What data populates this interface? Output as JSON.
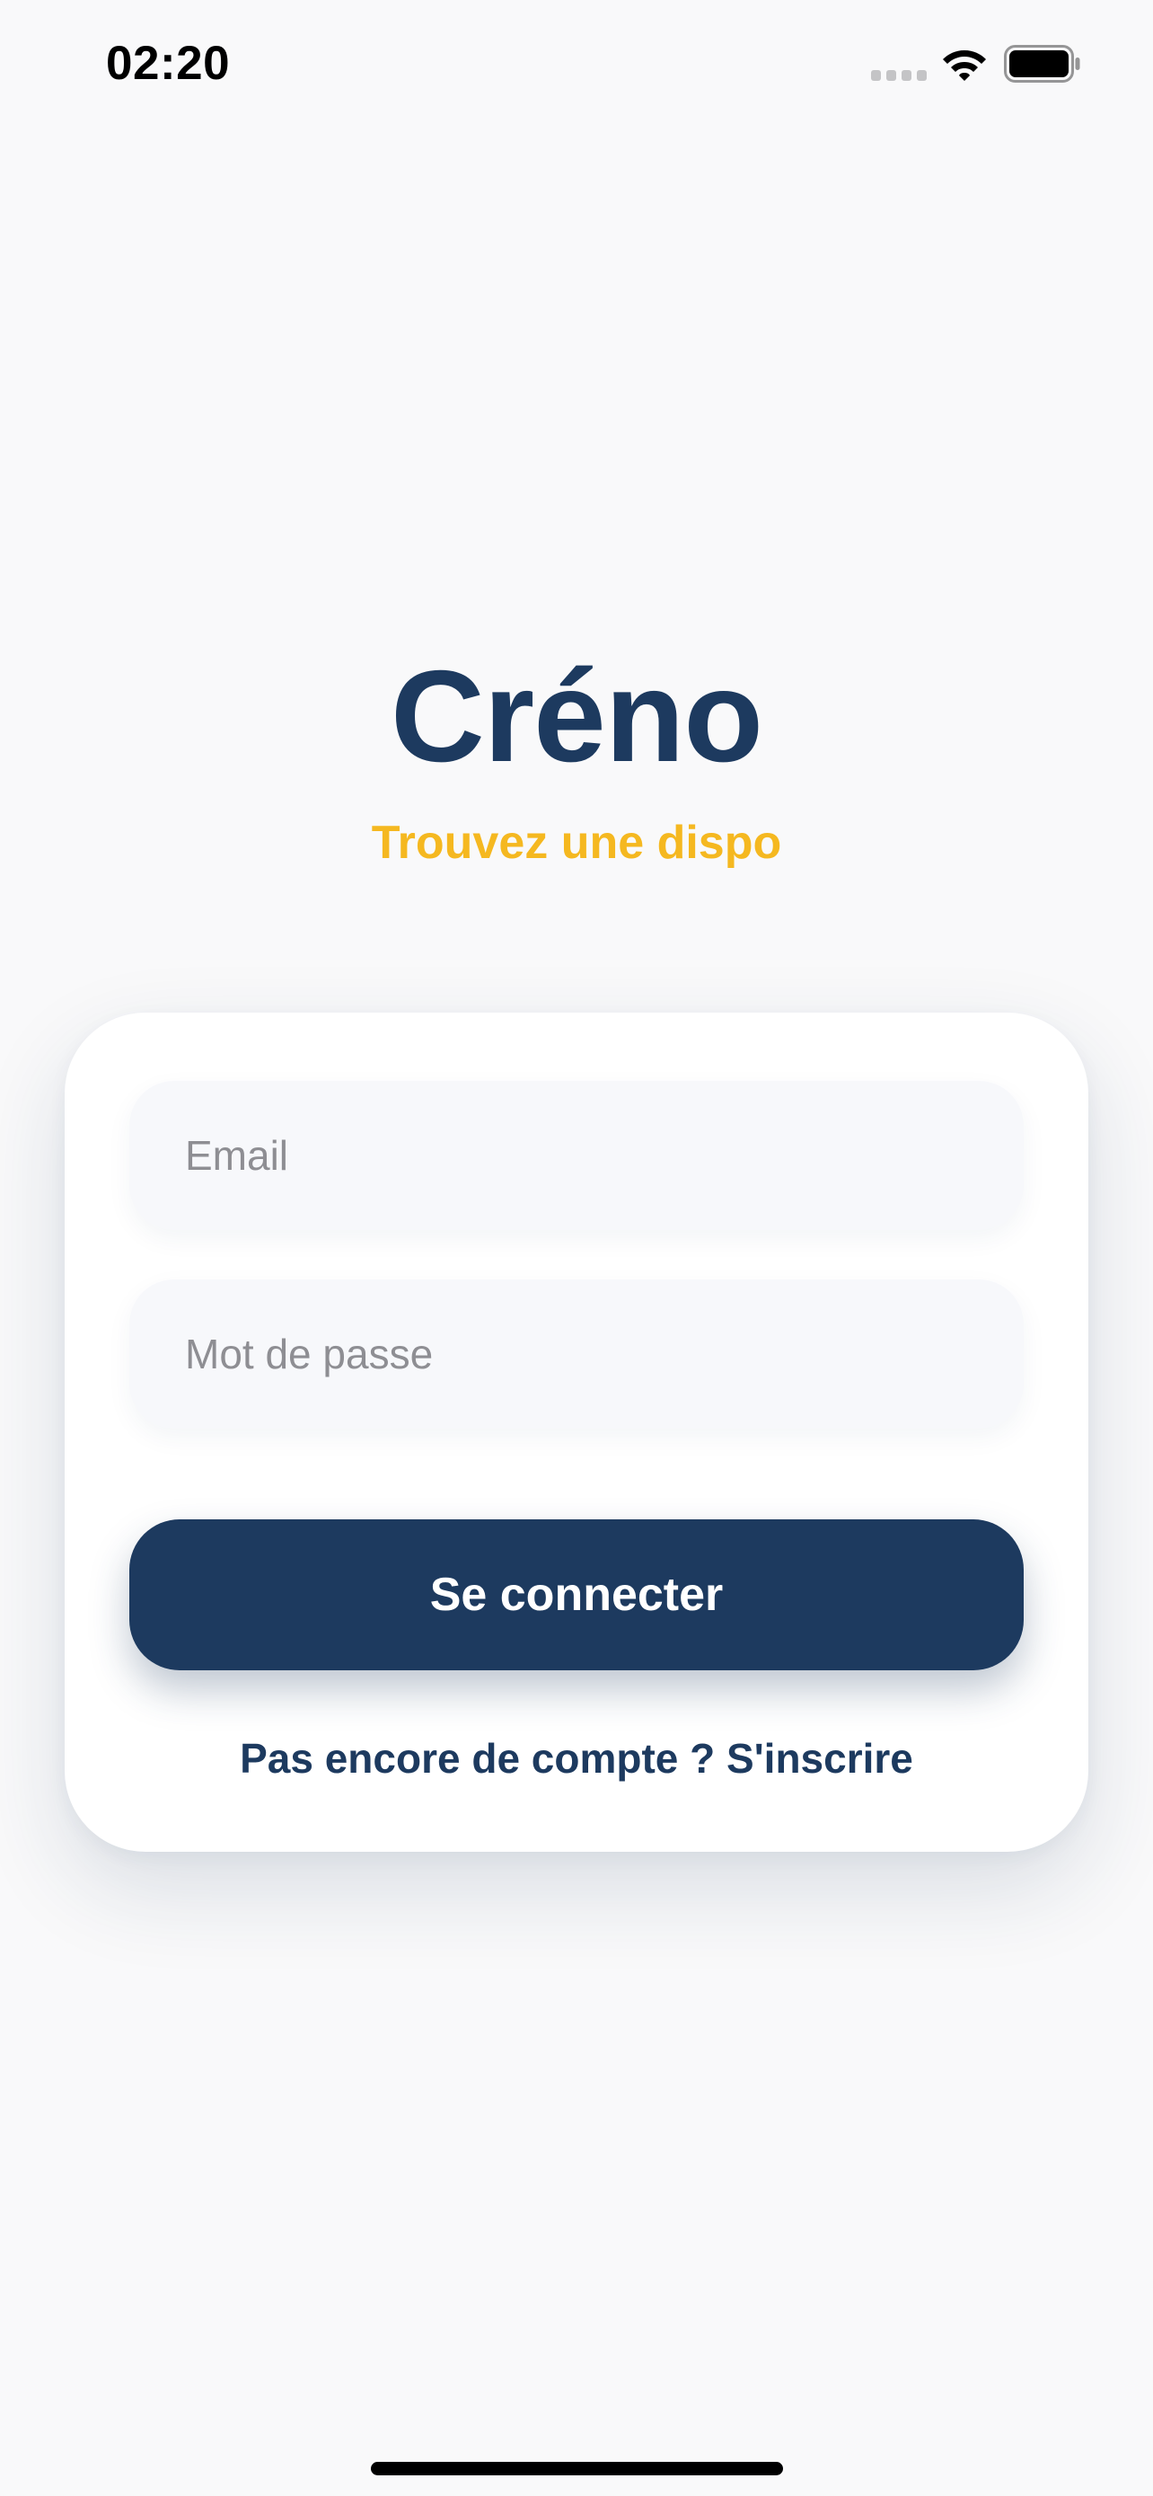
{
  "status_bar": {
    "time": "02:20",
    "icons": [
      "cellular-signal-icon",
      "wifi-icon",
      "battery-icon"
    ]
  },
  "brand": {
    "title": "Créno",
    "tagline": "Trouvez une dispo"
  },
  "login_form": {
    "email": {
      "value": "",
      "placeholder": "Email"
    },
    "password": {
      "value": "",
      "placeholder": "Mot de passe"
    },
    "submit_label": "Se connecter",
    "signup_link": "Pas encore de compte ? S'inscrire"
  },
  "colors": {
    "primary": "#1d3a5f",
    "accent": "#f5b820",
    "background": "#f9f9fa",
    "card": "#ffffff",
    "field": "#f7f8fb",
    "placeholder": "#8e8e93"
  }
}
